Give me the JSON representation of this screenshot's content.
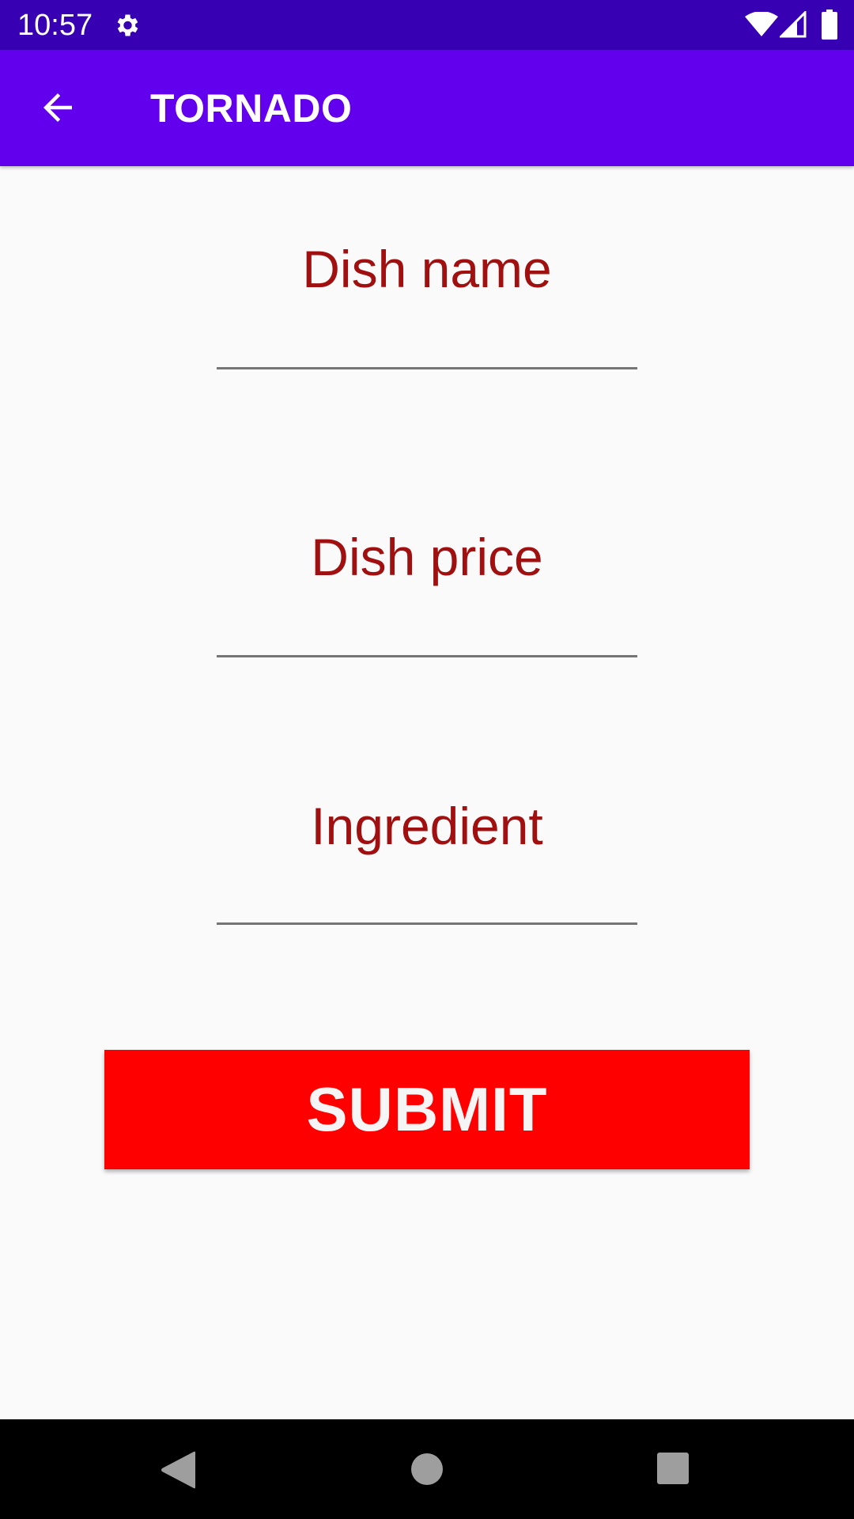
{
  "status_bar": {
    "time": "10:57",
    "icons": [
      "gear-icon",
      "wifi-icon",
      "signal-icon",
      "battery-icon"
    ]
  },
  "app_bar": {
    "title": "TORNADO",
    "back_icon": "arrow-left-icon",
    "background_color": "#6200ee"
  },
  "form": {
    "dish_name": {
      "value": "",
      "placeholder": "Dish name"
    },
    "dish_price": {
      "value": "",
      "placeholder": "Dish price"
    },
    "ingredient": {
      "value": "",
      "placeholder": "Ingredient"
    },
    "placeholder_color": "#a01010"
  },
  "submit": {
    "label": "SUBMIT",
    "background_color": "#ff0000"
  },
  "nav_bar": {
    "icons": [
      "nav-back-icon",
      "nav-home-icon",
      "nav-recents-icon"
    ]
  }
}
